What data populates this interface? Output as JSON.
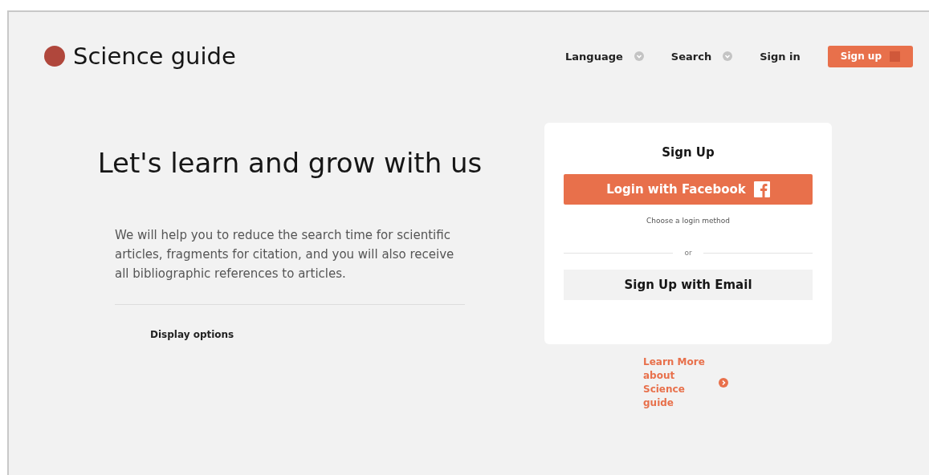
{
  "brand": {
    "name": "Science guide"
  },
  "nav": [
    {
      "kind": "dropdown",
      "label": "Language"
    },
    {
      "kind": "dropdown",
      "label": "Search"
    },
    {
      "kind": "link",
      "label": "Sign in"
    },
    {
      "kind": "button",
      "label": "Sign up"
    }
  ],
  "hero": {
    "heading": "Let's learn and grow with us",
    "text": "We will help you to reduce the search time for scientific articles, fragments for citation, and you will also receive all bibliographic references to articles.",
    "options_label": "Display options"
  },
  "signup_card": {
    "title": "Sign Up",
    "facebook_button": "Login with Facebook",
    "hint": "Choose a login method",
    "separator": "or",
    "email_button": "Sign Up with Email"
  },
  "learn_more": {
    "label": "Learn More about Science guide"
  }
}
